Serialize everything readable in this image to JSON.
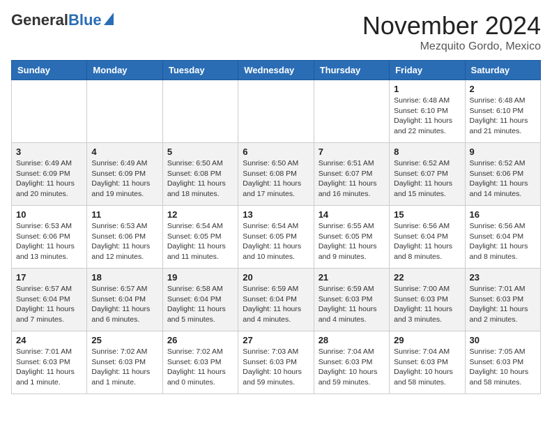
{
  "header": {
    "logo_general": "General",
    "logo_blue": "Blue",
    "month_title": "November 2024",
    "location": "Mezquito Gordo, Mexico"
  },
  "weekdays": [
    "Sunday",
    "Monday",
    "Tuesday",
    "Wednesday",
    "Thursday",
    "Friday",
    "Saturday"
  ],
  "weeks": [
    [
      {
        "day": "",
        "info": ""
      },
      {
        "day": "",
        "info": ""
      },
      {
        "day": "",
        "info": ""
      },
      {
        "day": "",
        "info": ""
      },
      {
        "day": "",
        "info": ""
      },
      {
        "day": "1",
        "info": "Sunrise: 6:48 AM\nSunset: 6:10 PM\nDaylight: 11 hours\nand 22 minutes."
      },
      {
        "day": "2",
        "info": "Sunrise: 6:48 AM\nSunset: 6:10 PM\nDaylight: 11 hours\nand 21 minutes."
      }
    ],
    [
      {
        "day": "3",
        "info": "Sunrise: 6:49 AM\nSunset: 6:09 PM\nDaylight: 11 hours\nand 20 minutes."
      },
      {
        "day": "4",
        "info": "Sunrise: 6:49 AM\nSunset: 6:09 PM\nDaylight: 11 hours\nand 19 minutes."
      },
      {
        "day": "5",
        "info": "Sunrise: 6:50 AM\nSunset: 6:08 PM\nDaylight: 11 hours\nand 18 minutes."
      },
      {
        "day": "6",
        "info": "Sunrise: 6:50 AM\nSunset: 6:08 PM\nDaylight: 11 hours\nand 17 minutes."
      },
      {
        "day": "7",
        "info": "Sunrise: 6:51 AM\nSunset: 6:07 PM\nDaylight: 11 hours\nand 16 minutes."
      },
      {
        "day": "8",
        "info": "Sunrise: 6:52 AM\nSunset: 6:07 PM\nDaylight: 11 hours\nand 15 minutes."
      },
      {
        "day": "9",
        "info": "Sunrise: 6:52 AM\nSunset: 6:06 PM\nDaylight: 11 hours\nand 14 minutes."
      }
    ],
    [
      {
        "day": "10",
        "info": "Sunrise: 6:53 AM\nSunset: 6:06 PM\nDaylight: 11 hours\nand 13 minutes."
      },
      {
        "day": "11",
        "info": "Sunrise: 6:53 AM\nSunset: 6:06 PM\nDaylight: 11 hours\nand 12 minutes."
      },
      {
        "day": "12",
        "info": "Sunrise: 6:54 AM\nSunset: 6:05 PM\nDaylight: 11 hours\nand 11 minutes."
      },
      {
        "day": "13",
        "info": "Sunrise: 6:54 AM\nSunset: 6:05 PM\nDaylight: 11 hours\nand 10 minutes."
      },
      {
        "day": "14",
        "info": "Sunrise: 6:55 AM\nSunset: 6:05 PM\nDaylight: 11 hours\nand 9 minutes."
      },
      {
        "day": "15",
        "info": "Sunrise: 6:56 AM\nSunset: 6:04 PM\nDaylight: 11 hours\nand 8 minutes."
      },
      {
        "day": "16",
        "info": "Sunrise: 6:56 AM\nSunset: 6:04 PM\nDaylight: 11 hours\nand 8 minutes."
      }
    ],
    [
      {
        "day": "17",
        "info": "Sunrise: 6:57 AM\nSunset: 6:04 PM\nDaylight: 11 hours\nand 7 minutes."
      },
      {
        "day": "18",
        "info": "Sunrise: 6:57 AM\nSunset: 6:04 PM\nDaylight: 11 hours\nand 6 minutes."
      },
      {
        "day": "19",
        "info": "Sunrise: 6:58 AM\nSunset: 6:04 PM\nDaylight: 11 hours\nand 5 minutes."
      },
      {
        "day": "20",
        "info": "Sunrise: 6:59 AM\nSunset: 6:04 PM\nDaylight: 11 hours\nand 4 minutes."
      },
      {
        "day": "21",
        "info": "Sunrise: 6:59 AM\nSunset: 6:03 PM\nDaylight: 11 hours\nand 4 minutes."
      },
      {
        "day": "22",
        "info": "Sunrise: 7:00 AM\nSunset: 6:03 PM\nDaylight: 11 hours\nand 3 minutes."
      },
      {
        "day": "23",
        "info": "Sunrise: 7:01 AM\nSunset: 6:03 PM\nDaylight: 11 hours\nand 2 minutes."
      }
    ],
    [
      {
        "day": "24",
        "info": "Sunrise: 7:01 AM\nSunset: 6:03 PM\nDaylight: 11 hours\nand 1 minute."
      },
      {
        "day": "25",
        "info": "Sunrise: 7:02 AM\nSunset: 6:03 PM\nDaylight: 11 hours\nand 1 minute."
      },
      {
        "day": "26",
        "info": "Sunrise: 7:02 AM\nSunset: 6:03 PM\nDaylight: 11 hours\nand 0 minutes."
      },
      {
        "day": "27",
        "info": "Sunrise: 7:03 AM\nSunset: 6:03 PM\nDaylight: 10 hours\nand 59 minutes."
      },
      {
        "day": "28",
        "info": "Sunrise: 7:04 AM\nSunset: 6:03 PM\nDaylight: 10 hours\nand 59 minutes."
      },
      {
        "day": "29",
        "info": "Sunrise: 7:04 AM\nSunset: 6:03 PM\nDaylight: 10 hours\nand 58 minutes."
      },
      {
        "day": "30",
        "info": "Sunrise: 7:05 AM\nSunset: 6:03 PM\nDaylight: 10 hours\nand 58 minutes."
      }
    ]
  ]
}
